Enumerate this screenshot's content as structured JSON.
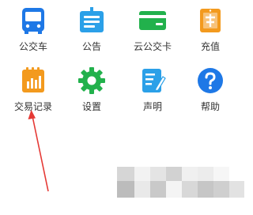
{
  "grid": {
    "items": [
      {
        "label": "公交车",
        "icon": "bus-icon",
        "color": "#1E78E6"
      },
      {
        "label": "公告",
        "icon": "announcement-icon",
        "color": "#2BA0E8"
      },
      {
        "label": "云公交卡",
        "icon": "card-icon",
        "color": "#22B14C"
      },
      {
        "label": "充值",
        "icon": "recharge-icon",
        "color": "#F39A1E"
      },
      {
        "label": "交易记录",
        "icon": "transaction-record-icon",
        "color": "#F39A1E"
      },
      {
        "label": "设置",
        "icon": "gear-icon",
        "color": "#22B14C"
      },
      {
        "label": "声明",
        "icon": "document-edit-icon",
        "color": "#2BA0E8"
      },
      {
        "label": "帮助",
        "icon": "help-icon",
        "color": "#1E78E6"
      }
    ]
  },
  "annotation": {
    "arrow_color": "#E53935",
    "icon": "red-arrow-icon"
  },
  "overlay": {
    "icon": "pixelated-mosaic-icon"
  },
  "colors": {
    "text": "#333333",
    "background": "#FFFFFF"
  }
}
